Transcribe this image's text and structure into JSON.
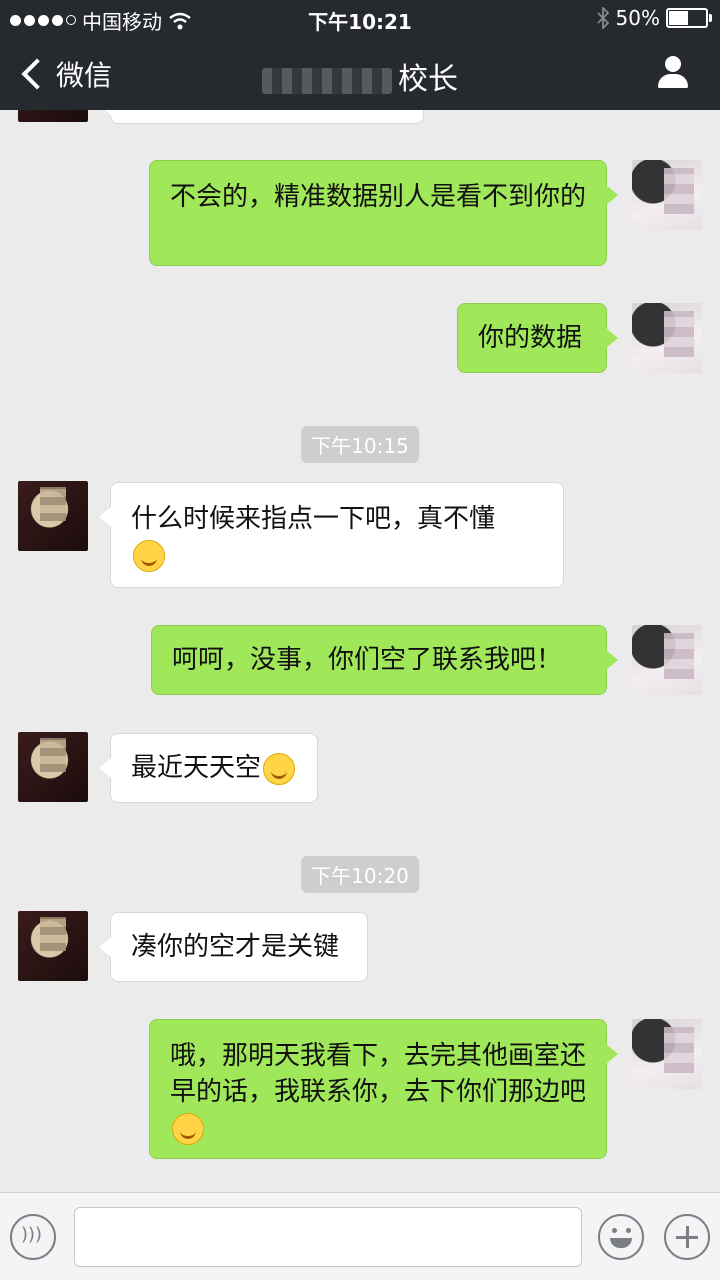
{
  "status_bar": {
    "carrier": "中国移动",
    "time": "下午10:21",
    "battery": "50%",
    "battery_level": 0.5
  },
  "nav": {
    "back_label": "微信",
    "title": "校长"
  },
  "messages": [
    {
      "side": "out",
      "text": "不会的，精准数据别人是看不到你的"
    },
    {
      "side": "out",
      "text": "你的数据"
    },
    {
      "type": "time",
      "text": "下午10:15"
    },
    {
      "side": "in",
      "text": "什么时候来指点一下吧，真不懂"
    },
    {
      "side": "out",
      "text": "呵呵，没事，你们空了联系我吧！"
    },
    {
      "side": "in",
      "text": "最近天天空"
    },
    {
      "type": "time",
      "text": "下午10:20"
    },
    {
      "side": "in",
      "text": "凑你的空才是关键"
    },
    {
      "side": "out",
      "text": "哦，那明天我看下，去完其他画室还早的话，我联系你，去下你们那边吧"
    }
  ],
  "colors": {
    "header_bg": "#262a2f",
    "chat_bg": "#ebebeb",
    "outgoing_bubble": "#a0e75a",
    "incoming_bubble": "#ffffff"
  },
  "icons": [
    "wifi-icon",
    "bluetooth-icon",
    "battery-icon",
    "back-chevron-icon",
    "profile-icon",
    "voice-icon",
    "emoji-icon",
    "plus-icon"
  ]
}
